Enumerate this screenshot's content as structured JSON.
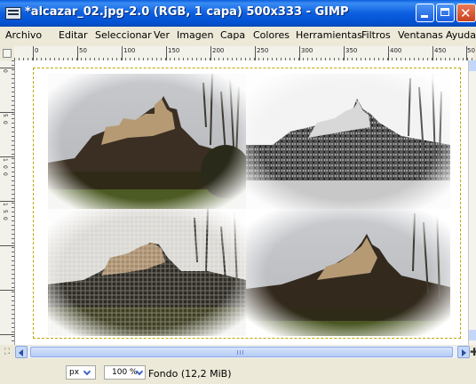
{
  "window": {
    "title": "*alcazar_02.jpg-2.0 (RGB, 1 capa) 500x333 - GIMP"
  },
  "menu": [
    {
      "label": "Archivo"
    },
    {
      "label": "Editar"
    },
    {
      "label": "Seleccionar"
    },
    {
      "label": "Ver"
    },
    {
      "label": "Imagen"
    },
    {
      "label": "Capa"
    },
    {
      "label": "Colores"
    },
    {
      "label": "Herramientas"
    },
    {
      "label": "Filtros"
    },
    {
      "label": "Ventanas"
    },
    {
      "label": "Ayuda"
    }
  ],
  "ruler": {
    "h_labels": [
      "0",
      "50",
      "100",
      "150",
      "200",
      "250",
      "300",
      "350",
      "400",
      "450",
      "50"
    ],
    "v_labels": [
      "0",
      "5",
      "0",
      "1",
      "0",
      "0",
      "1",
      "5",
      "0"
    ]
  },
  "status": {
    "unit": "px",
    "zoom": "100 %",
    "layer_info": "Fondo (12,2 MiB)"
  },
  "image_description_panels": [
    "original",
    "grayscale-edges",
    "texture-canvas",
    "vignette"
  ]
}
